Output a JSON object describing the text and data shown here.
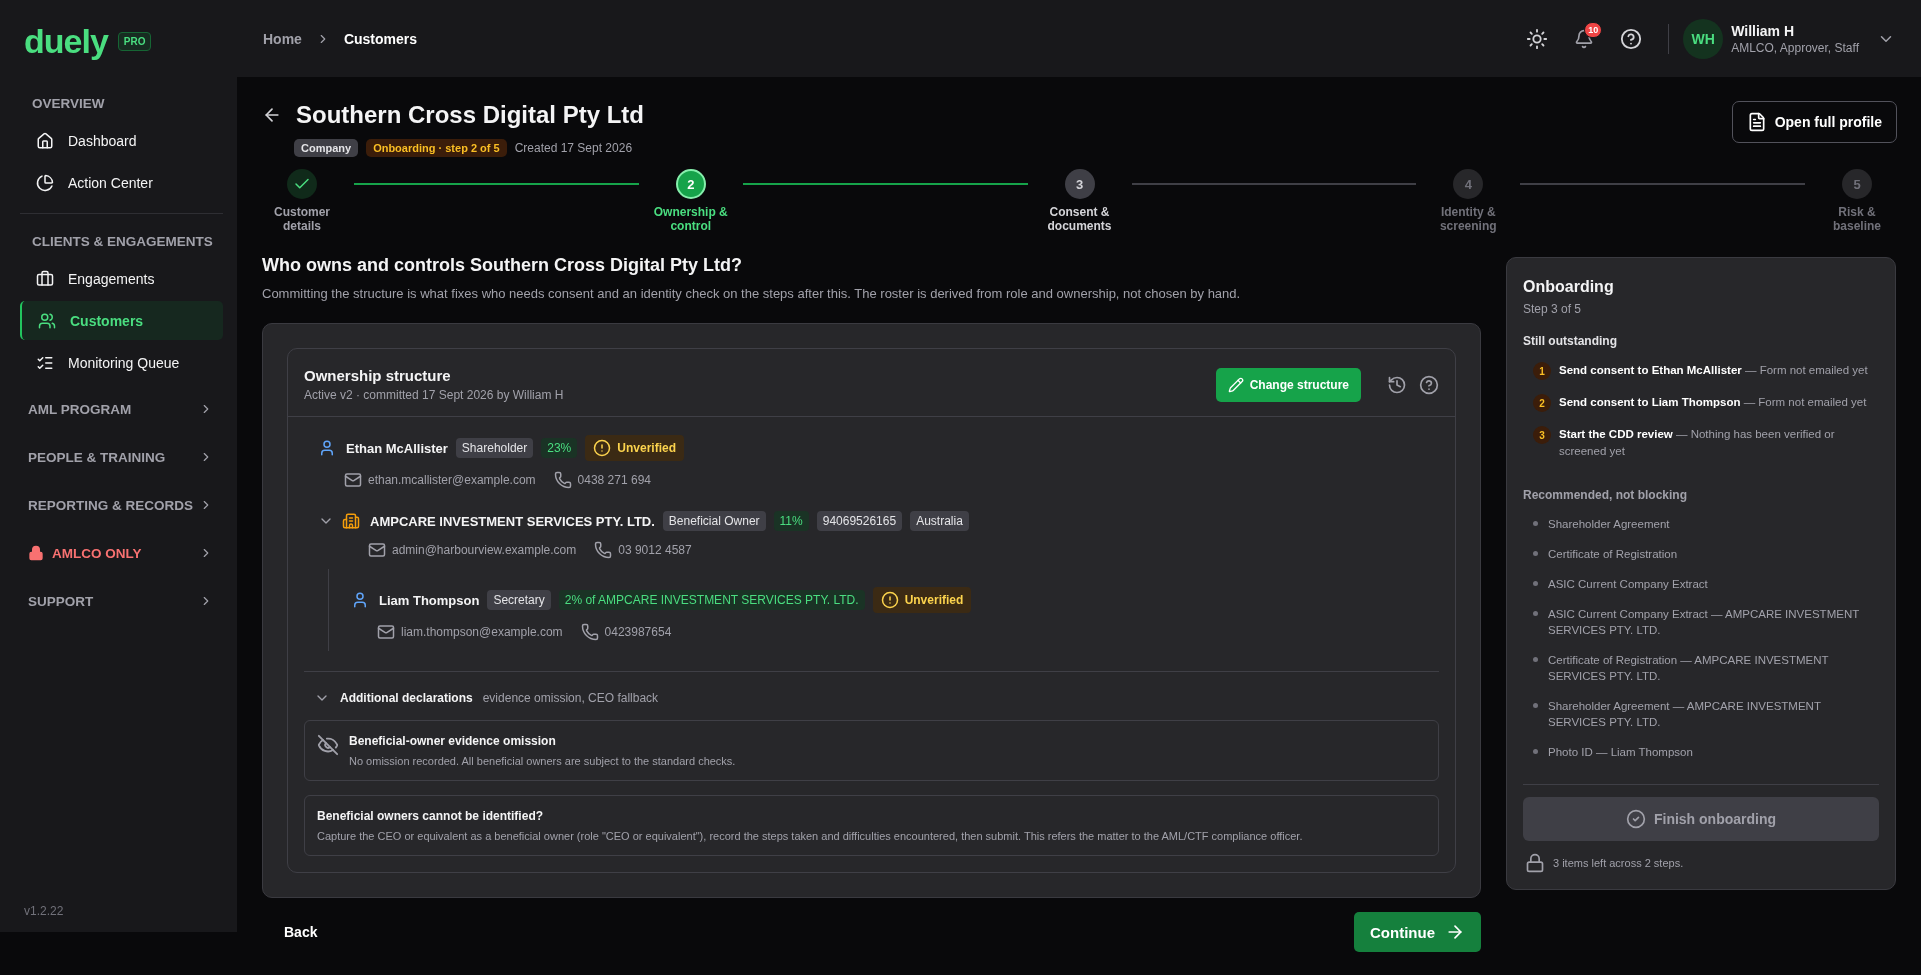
{
  "brand": {
    "logo": "duely",
    "badge": "PRO"
  },
  "sidebar": {
    "sections": [
      {
        "kind": "group",
        "title": "OVERVIEW",
        "items": [
          {
            "label": "Dashboard",
            "selected": false
          },
          {
            "label": "Action Center",
            "selected": false
          }
        ]
      },
      {
        "kind": "group",
        "title": "CLIENTS & ENGAGEMENTS",
        "items": [
          {
            "label": "Engagements",
            "selected": false
          },
          {
            "label": "Customers",
            "selected": true
          },
          {
            "label": "Monitoring Queue",
            "selected": false
          }
        ]
      },
      {
        "kind": "collapsed",
        "title": "AML PROGRAM"
      },
      {
        "kind": "collapsed",
        "title": "PEOPLE & TRAINING"
      },
      {
        "kind": "collapsed",
        "title": "REPORTING & RECORDS"
      },
      {
        "kind": "restricted",
        "title": "AMLCO ONLY"
      },
      {
        "kind": "collapsed",
        "title": "SUPPORT"
      }
    ],
    "version": "v1.2.22"
  },
  "header": {
    "breadcrumbs": [
      {
        "label": "Home",
        "current": false
      },
      {
        "label": "Customers",
        "current": true
      }
    ],
    "notifications": "10",
    "user": {
      "initials": "WH",
      "name": "William H",
      "roles": "AMLCO, Approver, Staff"
    }
  },
  "page": {
    "title": "Southern Cross Digital Pty Ltd",
    "tags": [
      {
        "label": "Company",
        "kind": "neutral"
      },
      {
        "label": "Onboarding · step 2 of 5",
        "kind": "warning"
      }
    ],
    "created": "Created 17 Sept 2026",
    "open_profile": "Open full profile"
  },
  "stepper": [
    {
      "label": "Customer details",
      "completed": true,
      "selected": false,
      "disabled": false
    },
    {
      "number": "2",
      "label": "Ownership & control",
      "completed": false,
      "selected": true,
      "disabled": false
    },
    {
      "number": "3",
      "label": "Consent & documents",
      "completed": false,
      "selected": false,
      "disabled": false
    },
    {
      "number": "4",
      "label": "Identity & screening",
      "completed": false,
      "selected": false,
      "disabled": true
    },
    {
      "number": "5",
      "label": "Risk & baseline",
      "completed": false,
      "selected": false,
      "disabled": true
    }
  ],
  "question": {
    "heading": "Who owns and controls Southern Cross Digital Pty Ltd?",
    "description": "Committing the structure is what fixes who needs consent and an identity check on the steps after this. The roster is derived from role and ownership, not chosen by hand."
  },
  "ownership": {
    "title": "Ownership structure",
    "subtitle": "Active v2 · committed 17 Sept 2026 by William H",
    "change_button": "Change structure",
    "entities": [
      {
        "kind": "person",
        "name": "Ethan McAllister",
        "tags": [
          {
            "label": "Shareholder",
            "kind": "role"
          },
          {
            "label": "23%",
            "kind": "share"
          }
        ],
        "status": "Unverified",
        "email": "ethan.mcallister@example.com",
        "phone": "0438 271 694"
      },
      {
        "kind": "company",
        "name": "AMPCARE INVESTMENT SERVICES PTY. LTD.",
        "expanded": true,
        "tags": [
          {
            "label": "Beneficial Owner",
            "kind": "role"
          },
          {
            "label": "11%",
            "kind": "share"
          },
          {
            "label": "94069526165",
            "kind": "role"
          },
          {
            "label": "Australia",
            "kind": "role"
          }
        ],
        "email": "admin@harbourview.example.com",
        "phone": "03 9012 4587",
        "children": [
          {
            "kind": "person",
            "name": "Liam Thompson",
            "tags": [
              {
                "label": "Secretary",
                "kind": "role"
              },
              {
                "label": "2% of AMPCARE INVESTMENT SERVICES PTY. LTD.",
                "kind": "share"
              }
            ],
            "status": "Unverified",
            "email": "liam.thompson@example.com",
            "phone": "0423987654"
          }
        ]
      }
    ],
    "declarations": {
      "title": "Additional declarations",
      "summary": "evidence omission, CEO fallback",
      "expanded": true,
      "cards": [
        {
          "kind": "omission",
          "title": "Beneficial-owner evidence omission",
          "text": "No omission recorded. All beneficial owners are subject to the standard checks."
        },
        {
          "kind": "plain",
          "title": "Beneficial owners cannot be identified?",
          "text": "Capture the CEO or equivalent as a beneficial owner (role \"CEO or equivalent\"), record the steps taken and difficulties encountered, then submit. This refers the matter to the AML/CTF compliance officer."
        }
      ]
    }
  },
  "footer": {
    "back": "Back",
    "continue": "Continue"
  },
  "onboarding": {
    "title": "Onboarding",
    "step": "Step 3 of 5",
    "outstanding_title": "Still outstanding",
    "outstanding": [
      {
        "number": "1",
        "text": "**Send consent to Ethan McAllister** — Form not emailed yet"
      },
      {
        "number": "2",
        "text": "**Send consent to Liam Thompson** — Form not emailed yet"
      },
      {
        "number": "3",
        "text": "**Start the CDD review** — Nothing has been verified or screened yet"
      }
    ],
    "recommended_title": "Recommended, not blocking",
    "recommended": [
      "Shareholder Agreement",
      "Certificate of Registration",
      "ASIC Current Company Extract",
      "ASIC Current Company Extract — AMPCARE INVESTMENT SERVICES PTY. LTD.",
      "Certificate of Registration — AMPCARE INVESTMENT SERVICES PTY. LTD.",
      "Shareholder Agreement — AMPCARE INVESTMENT SERVICES PTY. LTD.",
      "Photo ID — Liam Thompson"
    ],
    "finish": {
      "label": "Finish onboarding",
      "disabled": true
    },
    "remaining": "3 items left across 2 steps."
  }
}
